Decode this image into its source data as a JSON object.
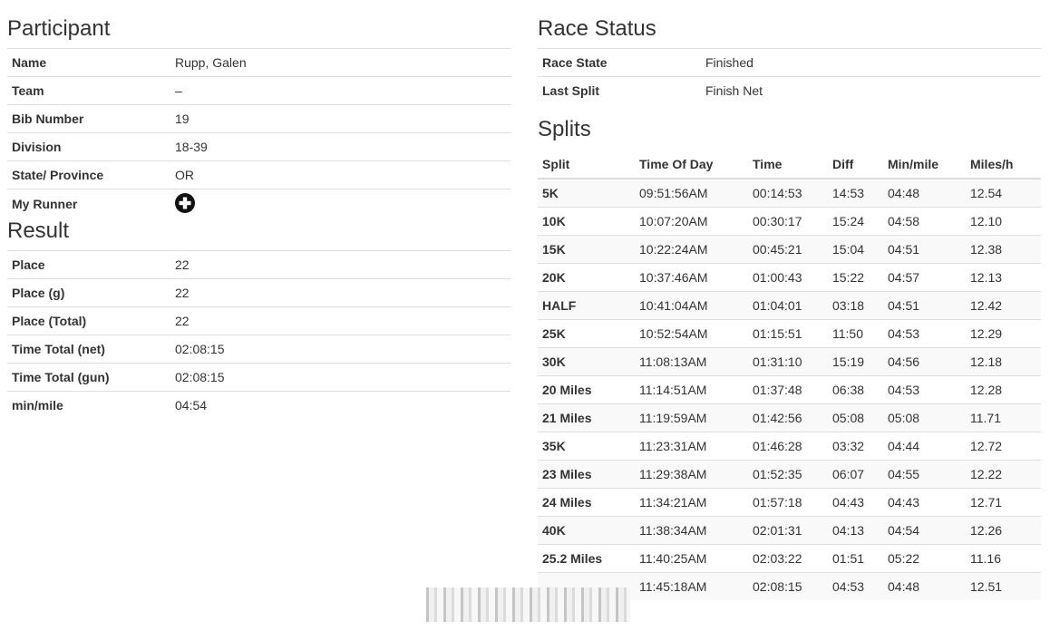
{
  "participant": {
    "title": "Participant",
    "rows": [
      {
        "label": "Name",
        "value": "Rupp, Galen"
      },
      {
        "label": "Team",
        "value": "–"
      },
      {
        "label": "Bib Number",
        "value": "19"
      },
      {
        "label": "Division",
        "value": "18-39"
      },
      {
        "label": "State/ Province",
        "value": "OR"
      }
    ],
    "my_runner_label": "My Runner",
    "my_runner_icon": "plus-circle-icon"
  },
  "result": {
    "title": "Result",
    "rows": [
      {
        "label": "Place",
        "value": "22"
      },
      {
        "label": "Place (g)",
        "value": "22"
      },
      {
        "label": "Place (Total)",
        "value": "22"
      },
      {
        "label": "Time Total (net)",
        "value": "02:08:15"
      },
      {
        "label": "Time Total (gun)",
        "value": "02:08:15"
      },
      {
        "label": "min/mile",
        "value": "04:54"
      }
    ]
  },
  "race_status": {
    "title": "Race Status",
    "rows": [
      {
        "label": "Race State",
        "value": "Finished"
      },
      {
        "label": "Last Split",
        "value": "Finish Net"
      }
    ]
  },
  "splits": {
    "title": "Splits",
    "headers": [
      "Split",
      "Time Of Day",
      "Time",
      "Diff",
      "Min/mile",
      "Miles/h"
    ],
    "rows": [
      [
        "5K",
        "09:51:56AM",
        "00:14:53",
        "14:53",
        "04:48",
        "12.54"
      ],
      [
        "10K",
        "10:07:20AM",
        "00:30:17",
        "15:24",
        "04:58",
        "12.10"
      ],
      [
        "15K",
        "10:22:24AM",
        "00:45:21",
        "15:04",
        "04:51",
        "12.38"
      ],
      [
        "20K",
        "10:37:46AM",
        "01:00:43",
        "15:22",
        "04:57",
        "12.13"
      ],
      [
        "HALF",
        "10:41:04AM",
        "01:04:01",
        "03:18",
        "04:51",
        "12.42"
      ],
      [
        "25K",
        "10:52:54AM",
        "01:15:51",
        "11:50",
        "04:53",
        "12.29"
      ],
      [
        "30K",
        "11:08:13AM",
        "01:31:10",
        "15:19",
        "04:56",
        "12.18"
      ],
      [
        "20 Miles",
        "11:14:51AM",
        "01:37:48",
        "06:38",
        "04:53",
        "12.28"
      ],
      [
        "21 Miles",
        "11:19:59AM",
        "01:42:56",
        "05:08",
        "05:08",
        "11.71"
      ],
      [
        "35K",
        "11:23:31AM",
        "01:46:28",
        "03:32",
        "04:44",
        "12.72"
      ],
      [
        "23 Miles",
        "11:29:38AM",
        "01:52:35",
        "06:07",
        "04:55",
        "12.22"
      ],
      [
        "24 Miles",
        "11:34:21AM",
        "01:57:18",
        "04:43",
        "04:43",
        "12.71"
      ],
      [
        "40K",
        "11:38:34AM",
        "02:01:31",
        "04:13",
        "04:54",
        "12.26"
      ],
      [
        "25.2 Miles",
        "11:40:25AM",
        "02:03:22",
        "01:51",
        "05:22",
        "11.16"
      ],
      [
        "",
        "11:45:18AM",
        "02:08:15",
        "04:53",
        "04:48",
        "12.51"
      ]
    ]
  }
}
